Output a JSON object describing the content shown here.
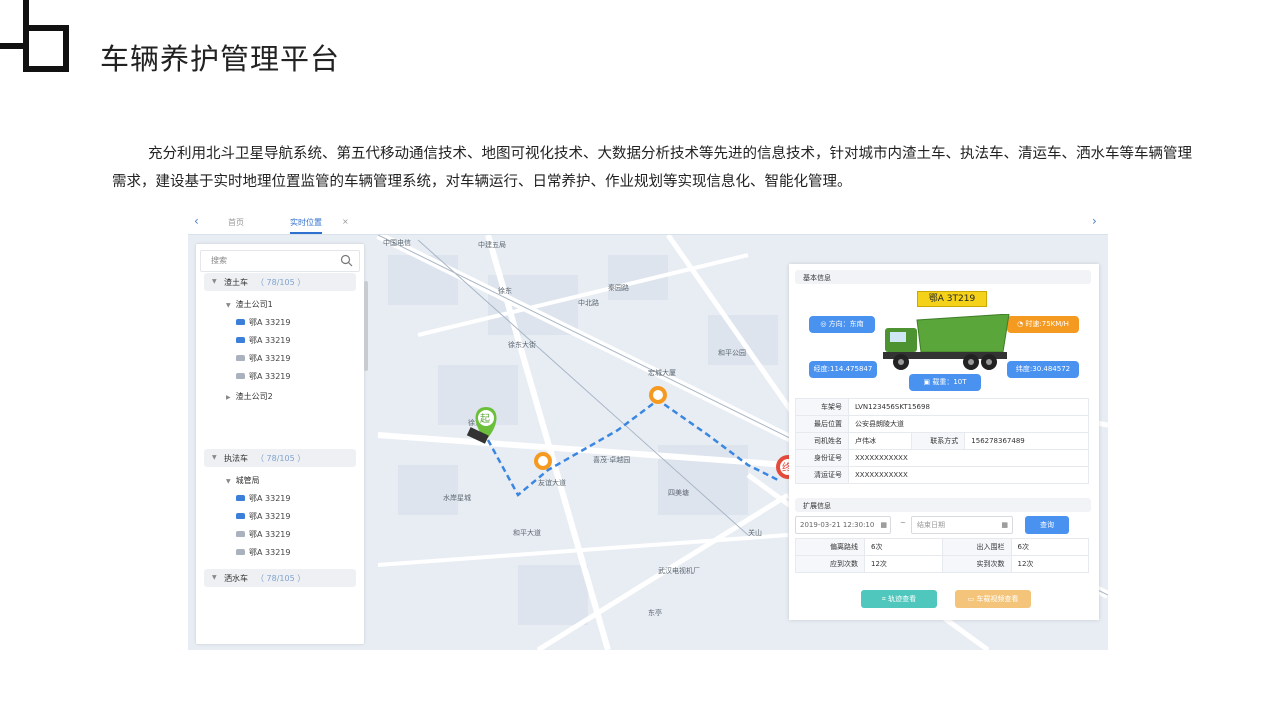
{
  "page": {
    "title": "车辆养护管理平台",
    "description": "充分利用北斗卫星导航系统、第五代移动通信技术、地图可视化技术、大数据分析技术等先进的信息技术，针对城市内渣土车、执法车、清运车、洒水车等车辆管理需求，建设基于实时地理位置监管的车辆管理系统，对车辆运行、日常养护、作业规划等实现信息化、智能化管理。"
  },
  "screenshot": {
    "nav": {
      "back": "‹",
      "forward": "›"
    },
    "tabs": [
      {
        "label": "首页"
      },
      {
        "label": "实时位置",
        "close": "×"
      }
    ],
    "map": {
      "labels": [
        "中国电信",
        "中建五局",
        "徐东",
        "徐东大街",
        "秦园路",
        "友谊大道",
        "水岸星城",
        "喜茂·卓越园",
        "和平大道",
        "东亭",
        "武汉电视机厂",
        "中北路",
        "宏城大厦",
        "四美塘",
        "和平公园",
        "徐东村",
        "关山"
      ],
      "start_marker": "起",
      "end_marker": "终"
    },
    "sidebar": {
      "search_placeholder": "搜索",
      "groups": [
        {
          "label": "渣土车",
          "count": "（ 78/105 ）",
          "companies": [
            {
              "label": "渣土公司1",
              "vehicles": [
                "鄂A 33219",
                "鄂A 33219",
                "鄂A 33219",
                "鄂A 33219"
              ]
            },
            {
              "label": "渣土公司2"
            }
          ]
        },
        {
          "label": "执法车",
          "count": "（ 78/105 ）",
          "companies": [
            {
              "label": "城管局",
              "vehicles": [
                "鄂A 33219",
                "鄂A 33219",
                "鄂A 33219",
                "鄂A 33219"
              ]
            }
          ]
        },
        {
          "label": "洒水车",
          "count": "（ 78/105 ）"
        }
      ]
    },
    "panel": {
      "basic_title": "基本信息",
      "plate": "鄂A 3T219",
      "direction": "方向：东南",
      "speed": "时速:75KM/H",
      "longitude": "经度:114.475847",
      "latitude": "纬度:30.484572",
      "load": "载重：10T",
      "info_rows": [
        {
          "key": "车架号",
          "value": "LVN123456SKT15698"
        },
        {
          "key": "最后位置",
          "value": "公安县朗陵大道"
        },
        {
          "key": "司机姓名",
          "value": "卢伟冰",
          "key2": "联系方式",
          "value2": "15627836748​9"
        },
        {
          "key": "身份证号",
          "value": "XXXXXXXXXXX"
        },
        {
          "key": "清运证号",
          "value": "XXXXXXXXXXX"
        }
      ],
      "ext_title": "扩展信息",
      "start_date": "2019-03-21 12:30:10",
      "date_sep": "~",
      "end_placeholder": "结束日期",
      "query_label": "查询",
      "stats": [
        {
          "k1": "偏离路线",
          "v1": "6次",
          "k2": "出入围栏",
          "v2": "6次"
        },
        {
          "k1": "应到次数",
          "v1": "12次",
          "k2": "实到次数",
          "v2": "12次"
        }
      ],
      "track_label": "轨迹查看",
      "video_label": "车载视频查看"
    },
    "colors": {
      "accent": "#4a92f0",
      "orange": "#f59a21",
      "teal": "#4fc7bd",
      "plate": "#f5d21a",
      "truck": "#5aa63a"
    }
  }
}
